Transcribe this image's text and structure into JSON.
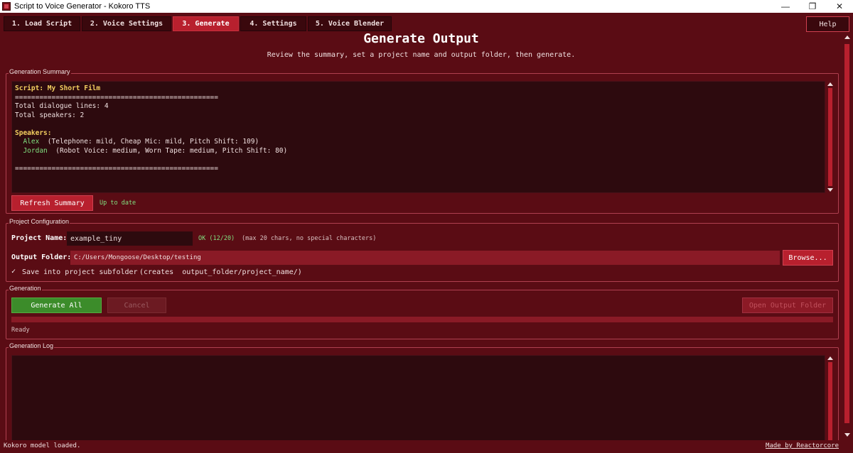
{
  "window": {
    "title": "Script to Voice Generator - Kokoro TTS",
    "minimize": "—",
    "restore": "❐",
    "close": "✕"
  },
  "tabs": [
    {
      "label": "1. Load Script"
    },
    {
      "label": "2. Voice Settings"
    },
    {
      "label": "3. Generate"
    },
    {
      "label": "4. Settings"
    },
    {
      "label": "5. Voice Blender"
    }
  ],
  "help_label": "Help",
  "page": {
    "title": "Generate Output",
    "subtitle": "Review the summary, set a project name and output folder, then generate."
  },
  "summary": {
    "group_label": "Generation Summary",
    "script_line": "Script: My Short Film",
    "separator": "==================================================",
    "dialogue_lines": "Total dialogue lines: 4",
    "speakers_total": "Total speakers: 2",
    "speakers_heading": "Speakers:",
    "speakers": [
      {
        "name": "Alex",
        "details": "(Telephone: mild, Cheap Mic: mild, Pitch Shift: 109)"
      },
      {
        "name": "Jordan",
        "details": "(Robot Voice: medium, Worn Tape: medium, Pitch Shift: 80)"
      }
    ],
    "refresh_label": "Refresh Summary",
    "status": "Up to date"
  },
  "project": {
    "group_label": "Project Configuration",
    "name_label": "Project Name:",
    "name_value": "example_tiny",
    "name_status": "OK (12/20)",
    "name_hint": "(max 20 chars, no special characters)",
    "folder_label": "Output Folder:",
    "folder_value": "C:/Users/Mongoose/Desktop/testing",
    "browse_label": "Browse...",
    "checkbox_mark": "✓",
    "subfolder_label": "Save into project subfolder",
    "subfolder_hint": "(creates  output_folder/project_name/)"
  },
  "generation": {
    "group_label": "Generation",
    "generate_label": "Generate All",
    "cancel_label": "Cancel",
    "open_folder_label": "Open Output Folder",
    "progress": 0,
    "status": "Ready"
  },
  "log": {
    "group_label": "Generation Log"
  },
  "statusbar": {
    "message": "Kokoro model loaded.",
    "credit": "Made by Reactorcore"
  }
}
